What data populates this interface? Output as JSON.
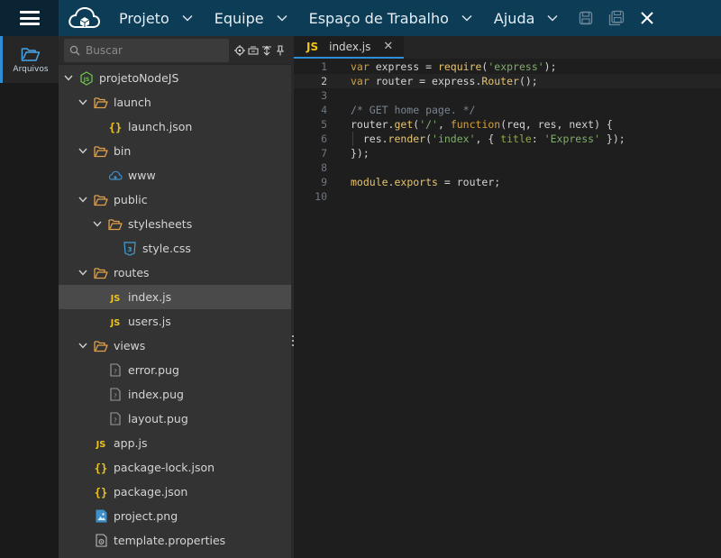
{
  "topbar": {
    "menus": [
      {
        "label": "Projeto"
      },
      {
        "label": "Equipe"
      },
      {
        "label": "Espaço de Trabalho"
      },
      {
        "label": "Ajuda"
      }
    ],
    "icons": [
      "menu-hamburger-icon",
      "cloud-logo-icon",
      "save-icon",
      "save-all-icon",
      "close-icon"
    ]
  },
  "activitybar": {
    "items": [
      {
        "label": "Arquivos",
        "icon": "folder-icon"
      }
    ]
  },
  "sidebar": {
    "search_placeholder": "Buscar",
    "tools": [
      "locate-icon",
      "collapse-all-icon",
      "filter-icon",
      "pin-icon"
    ],
    "tree": [
      {
        "name": "projetoNodeJS",
        "depth": 0,
        "type": "project",
        "expanded": true
      },
      {
        "name": "launch",
        "depth": 1,
        "type": "folder",
        "expanded": true
      },
      {
        "name": "launch.json",
        "depth": 2,
        "type": "json"
      },
      {
        "name": "bin",
        "depth": 1,
        "type": "folder",
        "expanded": true
      },
      {
        "name": "www",
        "depth": 2,
        "type": "cloud"
      },
      {
        "name": "public",
        "depth": 1,
        "type": "folder",
        "expanded": true
      },
      {
        "name": "stylesheets",
        "depth": 2,
        "type": "folder",
        "expanded": true
      },
      {
        "name": "style.css",
        "depth": 3,
        "type": "css"
      },
      {
        "name": "routes",
        "depth": 1,
        "type": "folder",
        "expanded": true
      },
      {
        "name": "index.js",
        "depth": 2,
        "type": "js",
        "selected": true
      },
      {
        "name": "users.js",
        "depth": 2,
        "type": "js"
      },
      {
        "name": "views",
        "depth": 1,
        "type": "folder",
        "expanded": true
      },
      {
        "name": "error.pug",
        "depth": 2,
        "type": "unknown"
      },
      {
        "name": "index.pug",
        "depth": 2,
        "type": "unknown"
      },
      {
        "name": "layout.pug",
        "depth": 2,
        "type": "unknown"
      },
      {
        "name": "app.js",
        "depth": 1,
        "type": "js"
      },
      {
        "name": "package-lock.json",
        "depth": 1,
        "type": "json"
      },
      {
        "name": "package.json",
        "depth": 1,
        "type": "json"
      },
      {
        "name": "project.png",
        "depth": 1,
        "type": "image"
      },
      {
        "name": "template.properties",
        "depth": 1,
        "type": "properties"
      }
    ]
  },
  "editor": {
    "tab": {
      "badge": "JS",
      "label": "index.js",
      "close": "✕"
    },
    "current_line": 2,
    "lines": [
      [
        [
          "kw",
          "var"
        ],
        [
          "p",
          " express = "
        ],
        [
          "fn",
          "require"
        ],
        [
          "p",
          "("
        ],
        [
          "str",
          "'express'"
        ],
        [
          "p",
          ");"
        ]
      ],
      [
        [
          "kw",
          "var"
        ],
        [
          "p",
          " router = express."
        ],
        [
          "fn",
          "Router"
        ],
        [
          "p",
          "();"
        ]
      ],
      [],
      [
        [
          "cm",
          "/* GET home page. */"
        ]
      ],
      [
        [
          "p",
          "router."
        ],
        [
          "fn",
          "get"
        ],
        [
          "p",
          "("
        ],
        [
          "str",
          "'/'"
        ],
        [
          "p",
          ", "
        ],
        [
          "kw",
          "function"
        ],
        [
          "p",
          "(req, res, next) {"
        ]
      ],
      [
        [
          "p",
          "  res."
        ],
        [
          "fn",
          "render"
        ],
        [
          "p",
          "("
        ],
        [
          "str",
          "'index'"
        ],
        [
          "p",
          ", { "
        ],
        [
          "prop",
          "title"
        ],
        [
          "p",
          ": "
        ],
        [
          "str",
          "'Express'"
        ],
        [
          "p",
          " });"
        ]
      ],
      [
        [
          "p",
          "});"
        ]
      ],
      [],
      [
        [
          "fn",
          "module"
        ],
        [
          "p",
          "."
        ],
        [
          "fn",
          "exports"
        ],
        [
          "p",
          " = router;"
        ]
      ],
      []
    ]
  },
  "colors": {
    "topbar": "#0c3c56",
    "accent": "#2f8fd5",
    "folder": "#e0a14a",
    "js": "#f0c419"
  }
}
